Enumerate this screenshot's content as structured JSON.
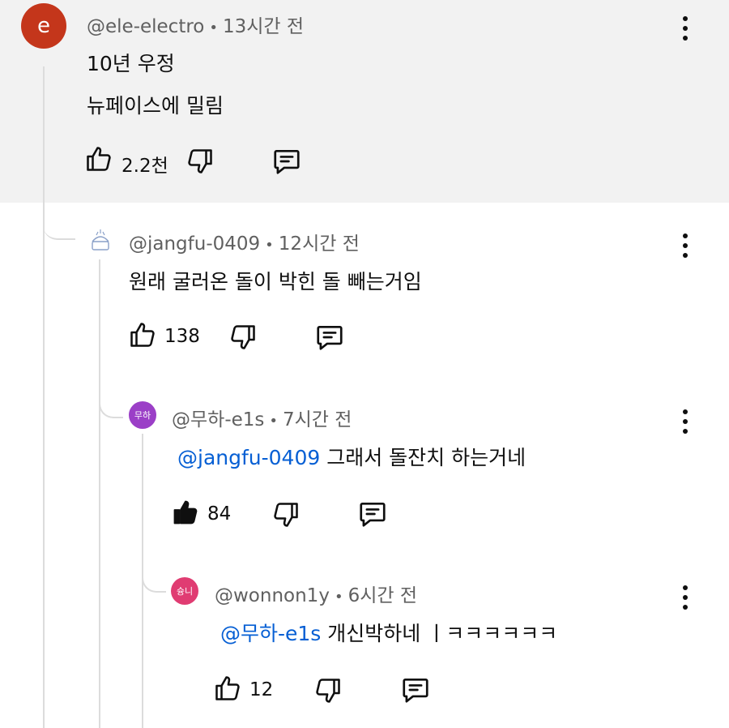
{
  "comments": [
    {
      "handle": "@ele-electro",
      "time": "13시간 전",
      "avatar_letter": "e",
      "avatar_color": "#c4361b",
      "lines": [
        "10년 우정",
        "뉴페이스에 밀림"
      ],
      "likes": "2.2천",
      "liked": false,
      "highlighted": true
    },
    {
      "handle": "@jangfu-0409",
      "time": "12시간 전",
      "avatar_letter": "",
      "avatar_color": "#ffffff",
      "text": "원래 굴러온 돌이 박힌 돌 빼는거임",
      "likes": "138",
      "liked": false
    },
    {
      "handle": "@무하-e1s",
      "time": "7시간 전",
      "avatar_letter": "무하",
      "avatar_color": "#9b3fc7",
      "mention": "@jangfu-0409",
      "text": " 그래서 돌잔치 하는거네",
      "likes": "84",
      "liked": true
    },
    {
      "handle": "@wonnon1y",
      "time": "6시간 전",
      "avatar_letter": "슝니",
      "avatar_color": "#e03c72",
      "mention": "@무하-e1s",
      "text": " 개신박하네 ㅣㅋㅋㅋㅋㅋㅋ",
      "likes": "12",
      "liked": false
    }
  ],
  "separator": "•",
  "icons": {
    "like": "thumbs-up-icon",
    "dislike": "thumbs-down-icon",
    "reply": "reply-comment-icon",
    "more": "more-vertical-icon"
  }
}
